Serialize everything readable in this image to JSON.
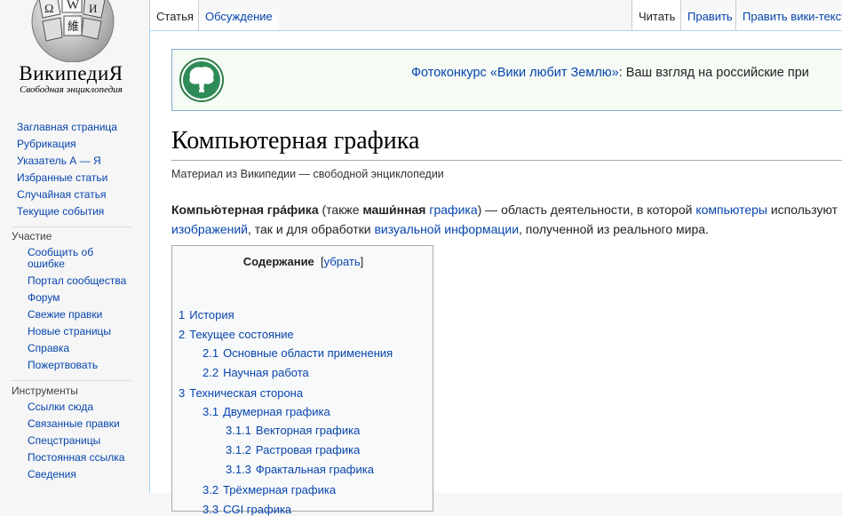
{
  "logo": {
    "name": "ВикипедиЯ",
    "tagline": "Свободная энциклопедия"
  },
  "nav": [
    "Заглавная страница",
    "Рубрикация",
    "Указатель А — Я",
    "Избранные статьи",
    "Случайная статья",
    "Текущие события"
  ],
  "participation": {
    "heading": "Участие",
    "items": [
      "Сообщить об ошибке",
      "Портал сообщества",
      "Форум",
      "Свежие правки",
      "Новые страницы",
      "Справка",
      "Пожертвовать"
    ]
  },
  "tools": {
    "heading": "Инструменты",
    "items": [
      "Ссылки сюда",
      "Связанные правки",
      "Спецстраницы",
      "Постоянная ссылка",
      "Сведения"
    ]
  },
  "tabs_left": [
    "Статья",
    "Обсуждение"
  ],
  "tabs_right": [
    "Читать",
    "Править",
    "Править вики-текст"
  ],
  "banner": {
    "link": "Фотоконкурс «Вики любит Землю»",
    "text": ": Ваш взгляд на российские при"
  },
  "article": {
    "title": "Компьютерная графика",
    "from": "Материал из Википедии — свободной энциклопедии",
    "lead": {
      "term": "Компью́терная гра́фика",
      "t1": " (также ",
      "term2": "маши́нная",
      "link1": "графика",
      "t2": ") — область деятельности, в которой ",
      "link2": "компьютеры",
      "t3": " используют",
      "link3": "изображений",
      "t4": ", так и для обработки ",
      "link4": "визуальной информации",
      "t5": ", полученной из реального мира."
    }
  },
  "toc": {
    "title": "Содержание",
    "toggle_open": "[",
    "toggle": "убрать",
    "toggle_close": "]",
    "items": [
      {
        "num": "1",
        "label": "История"
      },
      {
        "num": "2",
        "label": "Текущее состояние"
      },
      {
        "num": "2.1",
        "label": "Основные области применения"
      },
      {
        "num": "2.2",
        "label": "Научная работа"
      },
      {
        "num": "3",
        "label": "Техническая сторона"
      },
      {
        "num": "3.1",
        "label": "Двумерная графика"
      },
      {
        "num": "3.1.1",
        "label": "Векторная графика"
      },
      {
        "num": "3.1.2",
        "label": "Растровая графика"
      },
      {
        "num": "3.1.3",
        "label": "Фрактальная графика"
      },
      {
        "num": "3.2",
        "label": "Трёхмерная графика"
      },
      {
        "num": "3.3",
        "label": "CGI графика"
      }
    ]
  }
}
